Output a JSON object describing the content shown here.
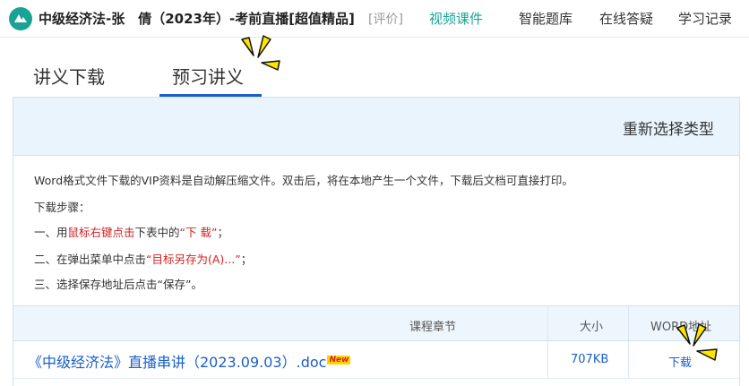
{
  "header": {
    "course_title": "中级经济法-张　倩（2023年）-考前直播[超值精品]",
    "rate_link": "[评价]",
    "nav": [
      {
        "label": "视频课件",
        "active": true
      },
      {
        "label": "智能题库",
        "active": false
      },
      {
        "label": "在线答疑",
        "active": false
      },
      {
        "label": "学习记录",
        "active": false
      }
    ]
  },
  "tabs": [
    {
      "label": "讲义下载",
      "active": false
    },
    {
      "label": "预习讲义",
      "active": true
    }
  ],
  "panel": {
    "reselect": "重新选择类型",
    "intro": "Word格式文件下载的VIP资料是自动解压缩文件。双击后，将在本地产生一个文件，下载后文档可直接打印。",
    "steps_title": "下载步骤：",
    "step1": {
      "prefix": "一、用",
      "highlight1": "鼠标右键点击",
      "middle": "下表中的",
      "highlight2": "“下 载”",
      "suffix": "；"
    },
    "step2": {
      "prefix": "二、在弹出菜单中点击",
      "highlight": "“目标另存为(A)...”",
      "suffix": "；"
    },
    "step3": "三、选择保存地址后点击“保存”。"
  },
  "table": {
    "headers": {
      "chapter": "课程章节",
      "size": "大小",
      "word": "WORD地址"
    },
    "rows": [
      {
        "title": "《中级经济法》直播串讲（2023.09.03）.doc",
        "badge": "New",
        "size": "707KB",
        "download": "下载"
      }
    ]
  },
  "colors": {
    "accent": "#1aa394",
    "link": "#1a5fc7",
    "highlight": "#d62020",
    "panel_bg": "#e9f4fc"
  }
}
